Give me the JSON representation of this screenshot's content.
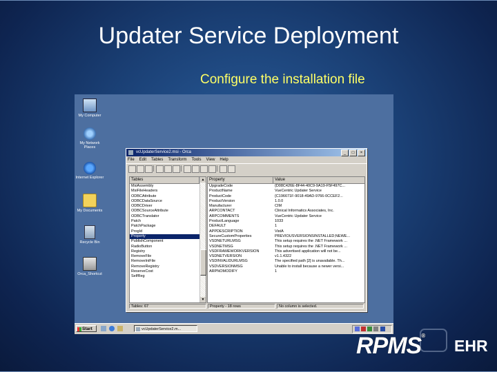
{
  "slide": {
    "title": "Updater Service Deployment",
    "subtitle": "Configure the installation file"
  },
  "desktop_icons": [
    {
      "label": "My Computer",
      "icon": "computer-icon"
    },
    {
      "label": "My Network Places",
      "icon": "network-icon"
    },
    {
      "label": "Internet Explorer",
      "icon": "internet-explorer-icon"
    },
    {
      "label": "My Documents",
      "icon": "folder-icon"
    },
    {
      "label": "Recycle Bin",
      "icon": "recycle-bin-icon"
    },
    {
      "label": "Orca_Shortcut",
      "icon": "orca-shortcut-icon"
    }
  ],
  "window": {
    "title": "vcUpdaterService2.msi - Orca",
    "menu": [
      "File",
      "Edit",
      "Tables",
      "Transform",
      "Tools",
      "View",
      "Help"
    ],
    "left_header": "Tables",
    "right_headers": [
      "Property",
      "Value"
    ],
    "tables": [
      "MsiAssembly",
      "MsiFileHeaders",
      "ODBCAttribute",
      "ODBCDataSource",
      "ODBCDriver",
      "ODBCSourceAttribute",
      "ODBCTranslator",
      "Patch",
      "PatchPackage",
      "ProgId",
      "Property",
      "PublishComponent",
      "RadioButton",
      "Registry",
      "RemoveFile",
      "RemoveIniFile",
      "RemoveRegistry",
      "ReserveCost",
      "SelfReg"
    ],
    "selected_table": "Property",
    "properties": [
      [
        "UpgradeCode",
        "{D08C426E-8F44-40C9-9A19-F5F497C..."
      ],
      [
        "ProductName",
        "VueCentric Updater Service"
      ],
      [
        "ProductCode",
        "{C196671F-9018-49AD-9766-0CCEF2..."
      ],
      [
        "ProductVersion",
        "1.0.0"
      ],
      [
        "Manufacturer",
        "CIM"
      ],
      [
        "ARPCONTACT",
        "Clinical Informatics Associates, Inc."
      ],
      [
        "ARPCOMMENTS",
        "VueCentric Updater Service"
      ],
      [
        "ProductLanguage",
        "1033"
      ],
      [
        "DEFAULT",
        "1"
      ],
      [
        "APPDESCRIPTION",
        "VistA"
      ],
      [
        "SecureCustomProperties",
        "PREVIOUSVERSIONSINSTALLED;NEWE..."
      ],
      [
        "VSDNETURLMSG",
        "This setup requires the .NET Framework ..."
      ],
      [
        "VSDNETMSG",
        "This setup requires the .NET Framework ..."
      ],
      [
        "VSDFRAMEWORKVERSION",
        "This advertised application will not be..."
      ],
      [
        "VSDNETVERSION",
        "v1.1.4322"
      ],
      [
        "VSDINVALIDURLMSG",
        "The specified path [2] is unavailable. Th..."
      ],
      [
        "VSDVERSIONMSG",
        "Unable to install because a newer versi..."
      ],
      [
        "ARPNOMODIFY",
        "1"
      ]
    ],
    "status": [
      "Tables: 67",
      "Property - 18 rows",
      "No column is selected."
    ]
  },
  "taskbar": {
    "start_label": "Start",
    "task_label": "vcUpdaterService2.m..."
  },
  "logo": {
    "brand": "RPMS",
    "registered": "®",
    "suffix": "EHR"
  }
}
